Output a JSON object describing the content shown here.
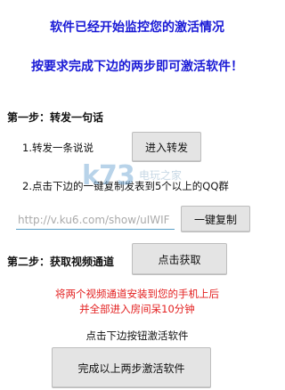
{
  "header": {
    "line1": "软件已经开始监控您的激活情况",
    "line2": "按要求完成下边的两步即可激活软件！"
  },
  "step1": {
    "label": "第一步：转发一句话",
    "item1_text": "1.转发一条说说",
    "item1_button": "进入转发",
    "item2_text": "2.点击下边的一键复制发表到5个以上的QQ群",
    "input_value": "http://v.ku6.com/show/uIWIF",
    "copy_button": "一键复制"
  },
  "step2": {
    "label": "第二步：获取视频通道",
    "get_button": "点击获取",
    "notice_line1": "将两个视频通道安装到您的手机上后",
    "notice_line2": "并全部进入房间呆10分钟"
  },
  "footer": {
    "hint": "点击下边按钮激活软件",
    "activate_button": "完成以上两步激活软件"
  },
  "watermark": {
    "logo_text": "k73",
    "sub_text": "电玩之家"
  }
}
